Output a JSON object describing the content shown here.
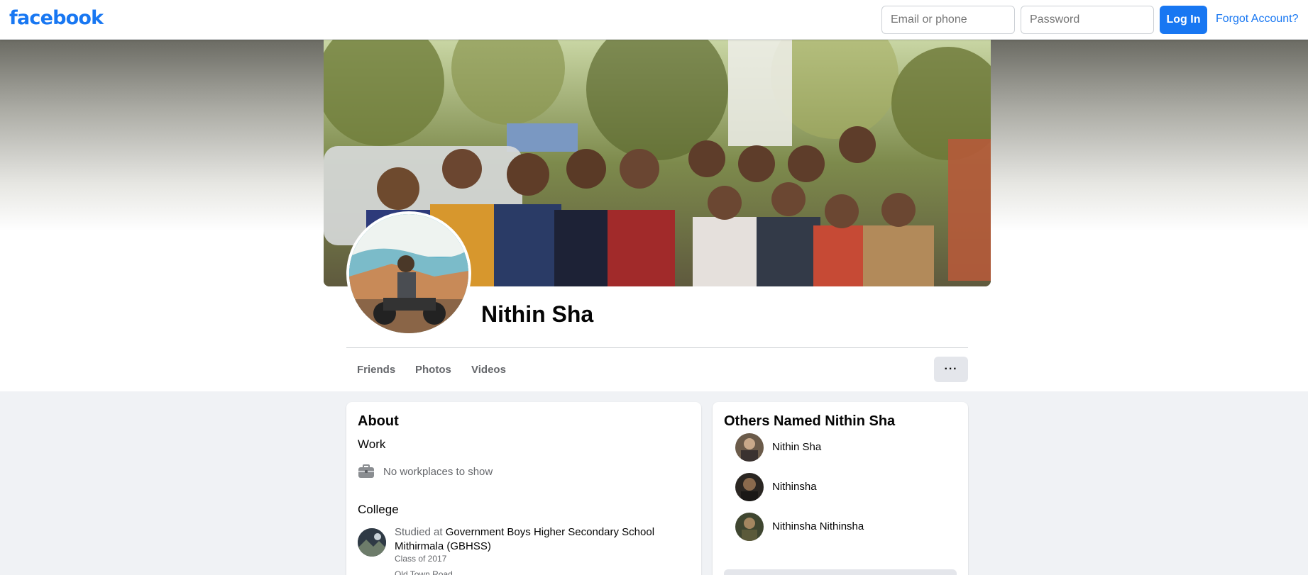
{
  "header": {
    "logo": "facebook",
    "email_placeholder": "Email or phone",
    "password_placeholder": "Password",
    "login_label": "Log In",
    "forgot_label": "Forgot Account?"
  },
  "profile": {
    "name": "Nithin Sha"
  },
  "tabs": [
    {
      "label": "Friends"
    },
    {
      "label": "Photos"
    },
    {
      "label": "Videos"
    }
  ],
  "more_label": "···",
  "about": {
    "title": "About",
    "work_title": "Work",
    "no_work": "No workplaces to show",
    "college_title": "College",
    "studied_prefix": "Studied at ",
    "school": "Government Boys Higher Secondary School Mithirmala (GBHSS)",
    "class_of": "Class of 2017",
    "cut_line": "Old Town Road"
  },
  "others": {
    "title": "Others Named Nithin Sha",
    "people": [
      {
        "name": "Nithin Sha"
      },
      {
        "name": "Nithinsha"
      },
      {
        "name": "Nithinsha Nithinsha"
      }
    ]
  },
  "colors": {
    "brand": "#1877f2",
    "page_bg": "#f0f2f5",
    "secondary_text": "#65676b"
  }
}
